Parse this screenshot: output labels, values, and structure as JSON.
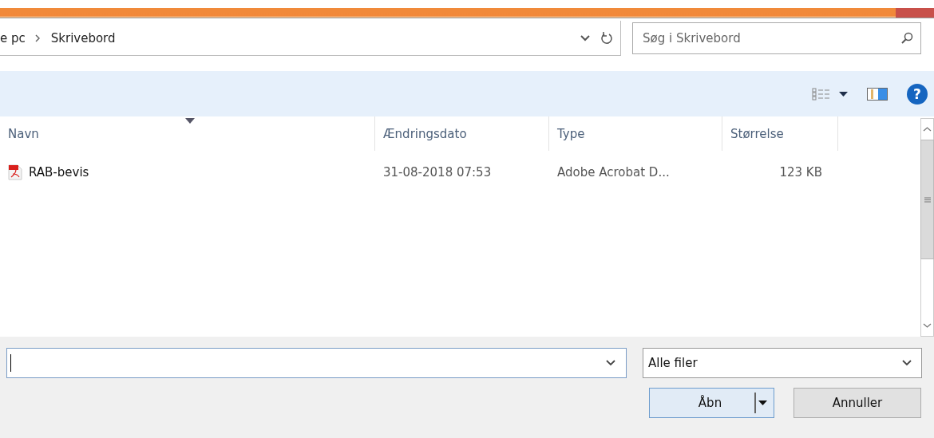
{
  "address": {
    "breadcrumb": [
      {
        "label": "e pc"
      },
      {
        "label": "Skrivebord"
      }
    ],
    "search": {
      "placeholder": "Søg i Skrivebord"
    }
  },
  "toolbar": {
    "help": "?"
  },
  "table": {
    "columns": [
      {
        "label": "Navn",
        "sorted": true
      },
      {
        "label": "Ændringsdato",
        "sorted": false
      },
      {
        "label": "Type",
        "sorted": false
      },
      {
        "label": "Størrelse",
        "sorted": false
      }
    ],
    "rows": [
      {
        "name": "RAB-bevis",
        "date": "31-08-2018 07:53",
        "type": "Adobe Acrobat D...",
        "size": "123 KB"
      }
    ]
  },
  "footer": {
    "file_type": "Alle filer",
    "buttons": [
      {
        "label": "Åbn",
        "kind": "split"
      },
      {
        "label": "Annuller",
        "kind": "plain"
      }
    ]
  }
}
